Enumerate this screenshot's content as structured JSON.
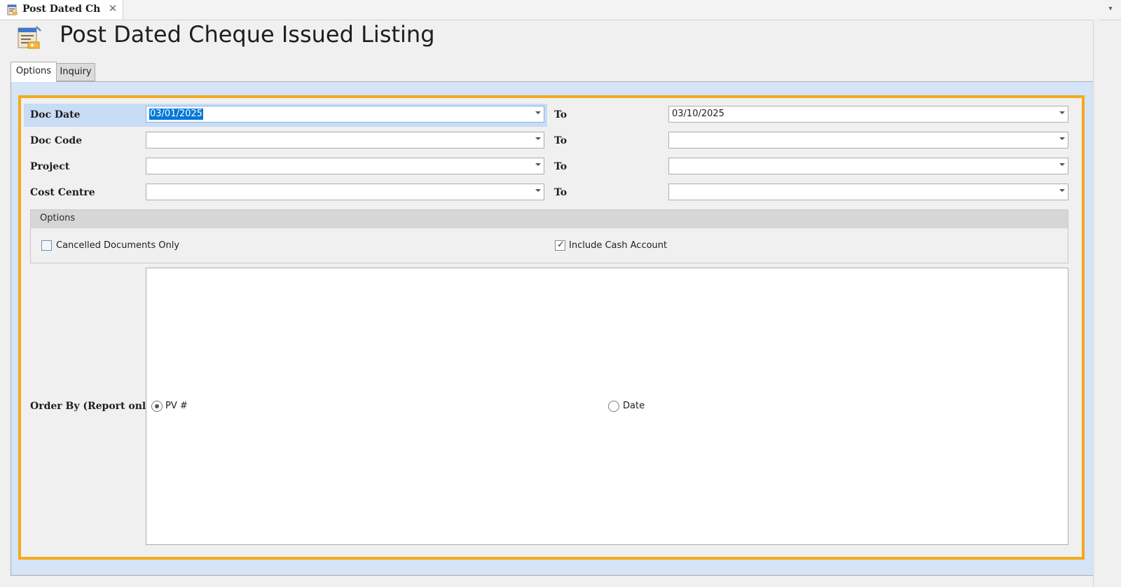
{
  "document_tab": {
    "label": "Post Dated Cheque Issued Listing",
    "close_glyph": "✕",
    "menu_glyph": "▾"
  },
  "page": {
    "title": "Post Dated Cheque Issued Listing"
  },
  "tabs": [
    {
      "label": "Options",
      "active": true
    },
    {
      "label": "Inquiry",
      "active": false
    }
  ],
  "filters": {
    "to_label": "To",
    "rows": [
      {
        "label": "Doc Date",
        "from": "03/01/2025",
        "to": "03/10/2025"
      },
      {
        "label": "Doc Code",
        "from": "",
        "to": ""
      },
      {
        "label": "Project",
        "from": "",
        "to": ""
      },
      {
        "label": "Cost Centre",
        "from": "",
        "to": ""
      }
    ]
  },
  "options": {
    "header": "Options",
    "cancelled_only": {
      "label": "Cancelled Documents Only",
      "checked": false
    },
    "include_cash": {
      "label": "Include Cash Account",
      "checked": true,
      "check_glyph": "✓"
    }
  },
  "order_by": {
    "label": "Order By (Report only)",
    "choices": [
      {
        "label": "PV #",
        "selected": true
      },
      {
        "label": "Date",
        "selected": false
      }
    ]
  },
  "colors": {
    "highlight_border": "#f5a91d",
    "selection": "#0078d7",
    "panel_bg": "#d5e4f7"
  }
}
